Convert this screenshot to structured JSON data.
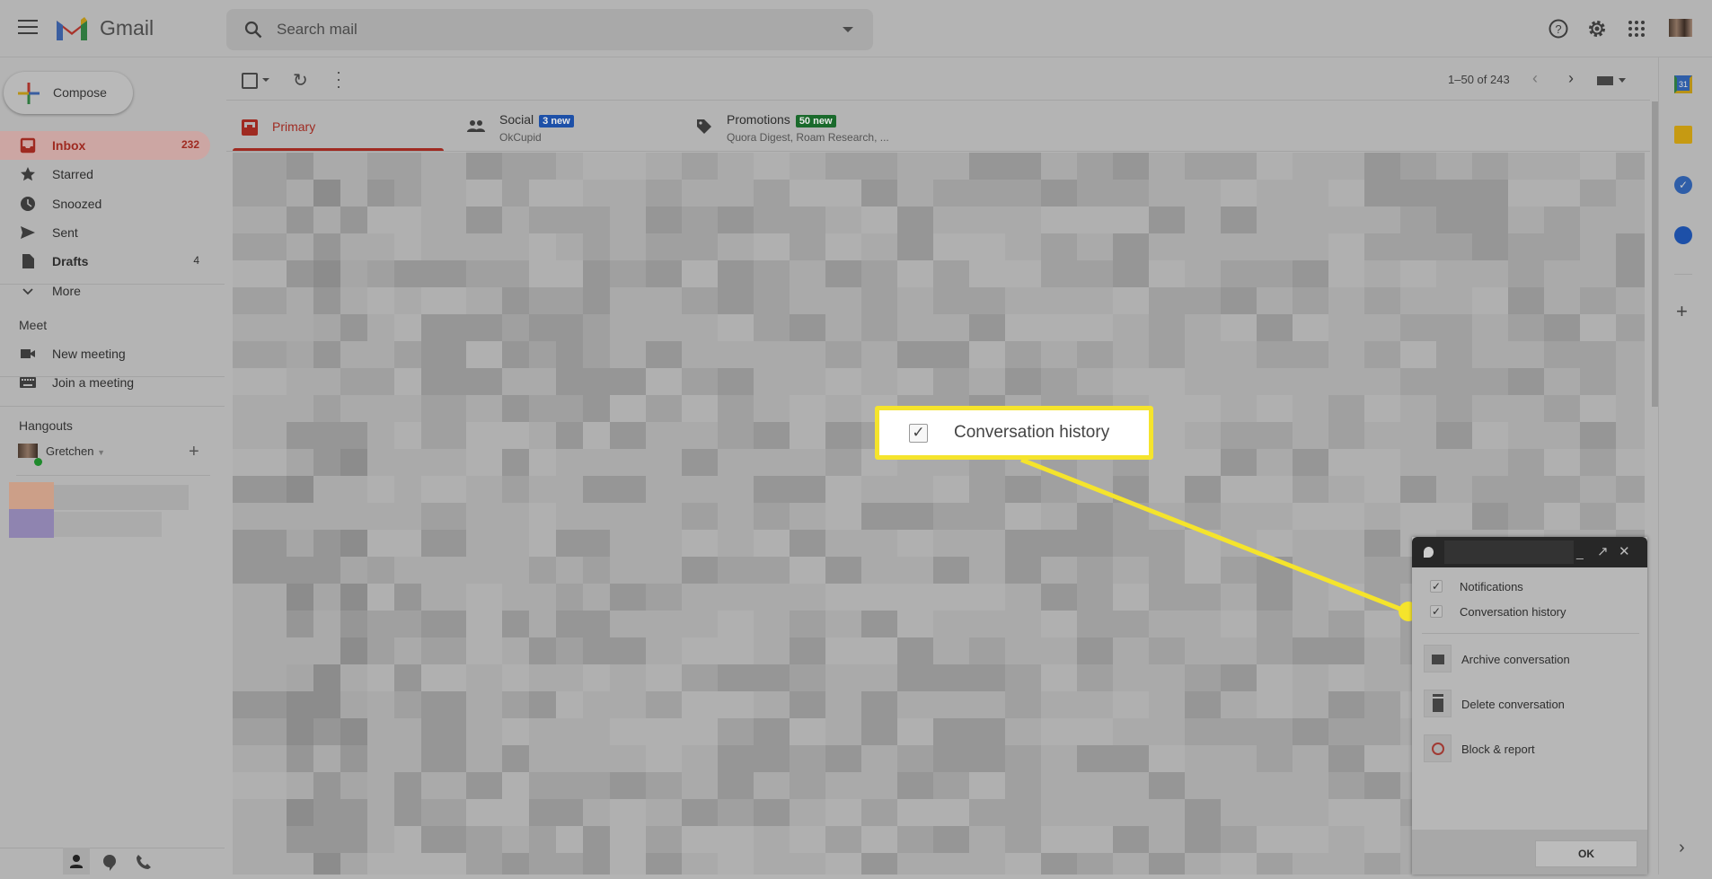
{
  "app": {
    "name": "Gmail"
  },
  "search": {
    "placeholder": "Search mail"
  },
  "compose": {
    "label": "Compose"
  },
  "nav": [
    {
      "label": "Inbox",
      "count": "232",
      "icon": "inbox-icon",
      "active": true
    },
    {
      "label": "Starred",
      "count": "",
      "icon": "star-icon"
    },
    {
      "label": "Snoozed",
      "count": "",
      "icon": "clock-icon"
    },
    {
      "label": "Sent",
      "count": "",
      "icon": "send-icon"
    },
    {
      "label": "Drafts",
      "count": "4",
      "icon": "draft-icon"
    },
    {
      "label": "More",
      "count": "",
      "icon": "chevron-down-icon"
    }
  ],
  "meet": {
    "title": "Meet",
    "items": [
      {
        "label": "New meeting",
        "icon": "video-icon"
      },
      {
        "label": "Join a meeting",
        "icon": "keyboard-icon"
      }
    ]
  },
  "hangouts": {
    "title": "Hangouts",
    "user": "Gretchen"
  },
  "toolbar": {
    "pagination": "1–50 of 243"
  },
  "tabs": [
    {
      "label": "Primary",
      "sub": "",
      "badge": ""
    },
    {
      "label": "Social",
      "sub": "OkCupid",
      "badge": "3 new",
      "badge_color": "#1d50a8"
    },
    {
      "label": "Promotions",
      "sub": "Quora Digest, Roam Research, ...",
      "badge": "50 new",
      "badge_color": "#1a6a2c"
    }
  ],
  "callout": {
    "label": "Conversation history",
    "highlight_color": "#f5e42c"
  },
  "chat_menu": {
    "checks": [
      {
        "label": "Notifications",
        "checked": true
      },
      {
        "label": "Conversation history",
        "checked": true
      }
    ],
    "actions": [
      {
        "label": "Archive conversation",
        "icon": "archive-icon"
      },
      {
        "label": "Delete conversation",
        "icon": "trash-icon"
      },
      {
        "label": "Block & report",
        "icon": "block-icon"
      }
    ],
    "ok": "OK"
  },
  "colors": {
    "accent": "#9f2a21"
  }
}
